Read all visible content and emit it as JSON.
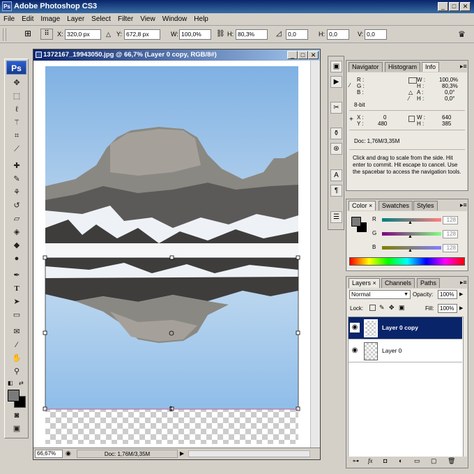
{
  "app": {
    "title": "Adobe Photoshop CS3",
    "logo": "Ps"
  },
  "menu": [
    "File",
    "Edit",
    "Image",
    "Layer",
    "Select",
    "Filter",
    "View",
    "Window",
    "Help"
  ],
  "options": {
    "x_label": "X:",
    "x_value": "320,0 px",
    "y_label": "Y:",
    "y_value": "672,8 px",
    "w_label": "W:",
    "w_value": "100,0%",
    "h_label": "H:",
    "h_value": "80,3%",
    "angle_value": "0,0",
    "hskew_label": "H:",
    "hskew_value": "0,0",
    "vskew_label": "V:",
    "vskew_value": "0,0"
  },
  "document": {
    "title": "1372167_19943050.jpg @ 66,7% (Layer 0 copy, RGB/8#)",
    "zoom": "66,67%",
    "doc_size": "Doc: 1,76M/3,35M"
  },
  "info_panel": {
    "tabs": [
      "Navigator",
      "Histogram",
      "Info"
    ],
    "r_label": "R :",
    "g_label": "G :",
    "b_label": "B :",
    "bit": "8-bit",
    "w_pct_label": "W :",
    "w_pct": "100,0%",
    "h_pct_label": "H :",
    "h_pct": "80,3%",
    "a_label": "A :",
    "a_val": "0,0°",
    "h2_label": "H :",
    "h2_val": "0,0°",
    "x_label": "X :",
    "x_val": "0",
    "y_label": "Y :",
    "y_val": "480",
    "w_label": "W :",
    "w_val": "640",
    "h_label": "H :",
    "h_val": "385",
    "doc": "Doc: 1,76M/3,35M",
    "help": "Click and drag to scale from the side. Hit enter to commit. Hit escape to cancel. Use the spacebar to access the navigation tools."
  },
  "color_panel": {
    "tabs": [
      "Color",
      "Swatches",
      "Styles"
    ],
    "r_label": "R",
    "r_val": "128",
    "g_label": "G",
    "g_val": "128",
    "b_label": "B",
    "b_val": "128"
  },
  "layers_panel": {
    "tabs": [
      "Layers",
      "Channels",
      "Paths"
    ],
    "blend_mode": "Normal",
    "opacity_label": "Opacity:",
    "opacity": "100%",
    "lock_label": "Lock:",
    "fill_label": "Fill:",
    "fill": "100%",
    "layers": [
      {
        "name": "Layer 0 copy",
        "selected": true
      },
      {
        "name": "Layer 0",
        "selected": false
      }
    ]
  },
  "colors": {
    "titlebar": "#0a246a",
    "selection": "#0a246a",
    "sky": "#9ec4e8"
  }
}
